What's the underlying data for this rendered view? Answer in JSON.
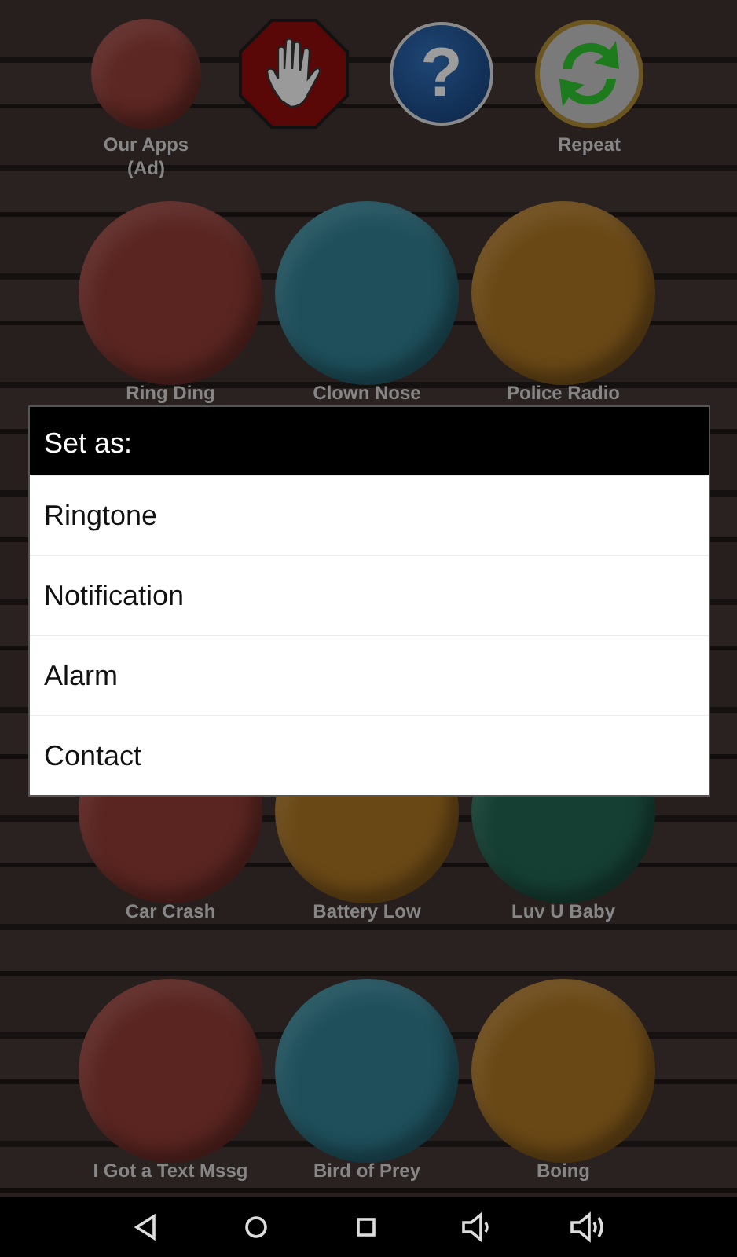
{
  "top_buttons": [
    {
      "kind": "apps",
      "label": "Our Apps\n(Ad)",
      "color": "#5c2622"
    },
    {
      "kind": "stop"
    },
    {
      "kind": "help",
      "symbol": "?"
    },
    {
      "kind": "repeat",
      "label": "Repeat"
    }
  ],
  "sounds": [
    {
      "label": "Ring Ding",
      "color": "#5a2521"
    },
    {
      "label": "Clown Nose",
      "color": "#1e4f5b"
    },
    {
      "label": "Police Radio",
      "color": "#6a4816"
    },
    {
      "label": "Car Crash",
      "color": "#5a2521"
    },
    {
      "label": "Battery Low",
      "color": "#6a4816"
    },
    {
      "label": "Luv U Baby",
      "color": "#163f33"
    },
    {
      "label": "I Got a Text Mssg",
      "color": "#5a2521"
    },
    {
      "label": "Bird of Prey",
      "color": "#1e4f5b"
    },
    {
      "label": "Boing",
      "color": "#6a4816"
    }
  ],
  "dialog": {
    "title": "Set as:",
    "items": [
      "Ringtone",
      "Notification",
      "Alarm",
      "Contact"
    ]
  }
}
